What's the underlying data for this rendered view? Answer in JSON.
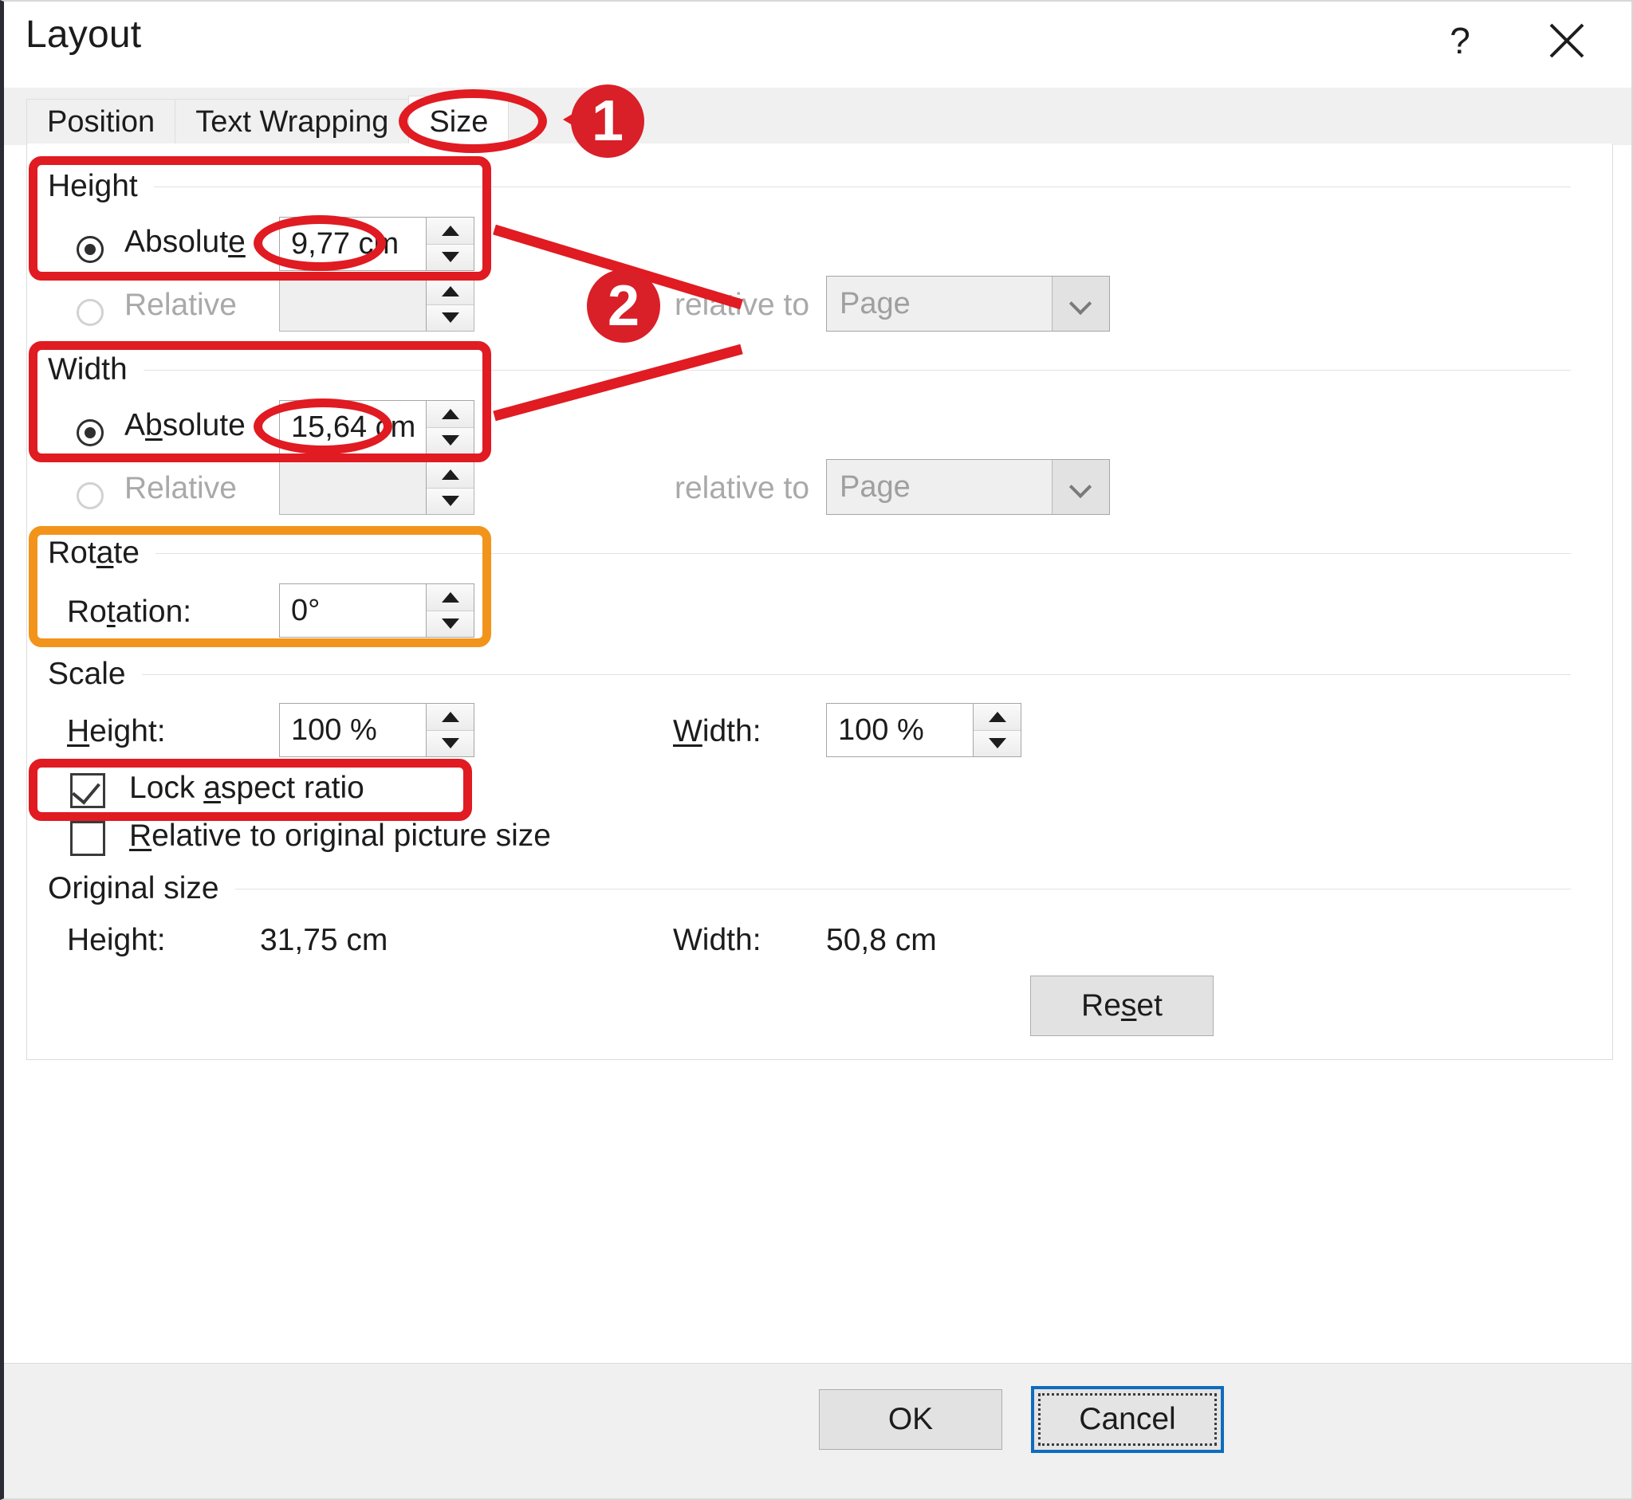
{
  "dialog": {
    "title": "Layout",
    "help_icon": "question-mark-icon",
    "close_icon": "close-x-icon"
  },
  "tabs": [
    {
      "label": "Position",
      "active": false
    },
    {
      "label": "Text Wrapping",
      "active": false
    },
    {
      "label": "Size",
      "active": true
    }
  ],
  "height_group": {
    "legend": "Height",
    "absolute": {
      "label_pre": "Absolut",
      "label_accel": "e",
      "label_post": "",
      "value": "9,77 cm",
      "selected": true
    },
    "relative": {
      "label": "Relative",
      "value": "",
      "selected": false,
      "relative_to_label": "relative to",
      "relative_to_value": "Page",
      "disabled": true
    }
  },
  "width_group": {
    "legend": "Width",
    "absolute": {
      "label_pre": "A",
      "label_accel": "b",
      "label_post": "solute",
      "value": "15,64 cm",
      "selected": true
    },
    "relative": {
      "label": "Relative",
      "value": "",
      "selected": false,
      "relative_to_label": "relative to",
      "relative_to_value": "Page",
      "disabled": true
    }
  },
  "rotate_group": {
    "legend_pre": "Rot",
    "legend_accel": "a",
    "legend_post": "te",
    "rotation_pre": "Ro",
    "rotation_accel": "t",
    "rotation_post": "ation:",
    "rotation_value": "0°"
  },
  "scale_group": {
    "legend": "Scale",
    "height_accel": "H",
    "height_post": "eight:",
    "height_value": "100 %",
    "width_accel": "W",
    "width_post": "idth:",
    "width_value": "100 %",
    "lock_aspect": {
      "pre": "Lock ",
      "accel": "a",
      "post": "spect ratio",
      "checked": true
    },
    "relative_original": {
      "accel": "R",
      "post": "elative to original picture size",
      "checked": false
    }
  },
  "original_size_group": {
    "legend": "Original size",
    "height_label": "Height:",
    "height_value": "31,75 cm",
    "width_label": "Width:",
    "width_value": "50,8 cm"
  },
  "buttons": {
    "reset_pre": "Re",
    "reset_accel": "s",
    "reset_post": "et",
    "ok": "OK",
    "cancel": "Cancel"
  },
  "annotations": {
    "badge_one": "1",
    "badge_two": "2",
    "highlight_color": "#e01b22",
    "secondary_highlight_color": "#f2941b"
  }
}
